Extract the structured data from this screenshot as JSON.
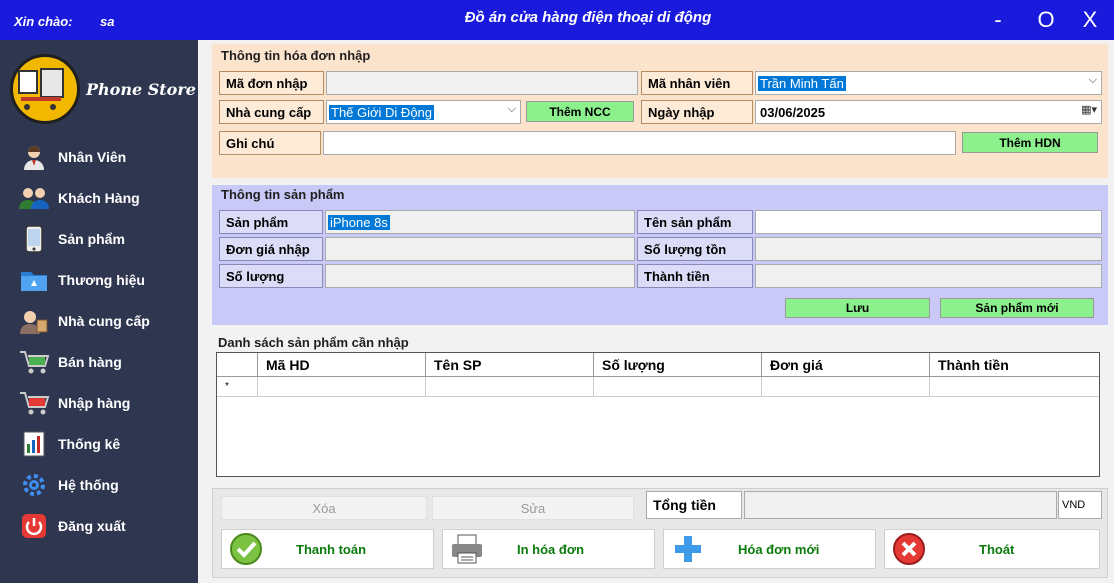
{
  "window": {
    "greeting": "Xin chào:",
    "user": "sa",
    "title": "Đồ án cửa hàng điện thoại di động",
    "min_glyph": "-",
    "max_glyph": "O",
    "close_glyph": "X"
  },
  "logo": {
    "text": "Phone Store"
  },
  "sidebar": {
    "items": [
      {
        "label": "Nhân Viên",
        "icon": "employee-icon"
      },
      {
        "label": "Khách Hàng",
        "icon": "customers-icon"
      },
      {
        "label": "Sản phẩm",
        "icon": "phone-icon"
      },
      {
        "label": "Thương hiệu",
        "icon": "folder-icon"
      },
      {
        "label": "Nhà cung cấp",
        "icon": "supplier-icon"
      },
      {
        "label": "Bán hàng",
        "icon": "cart-icon"
      },
      {
        "label": "Nhập hàng",
        "icon": "cart-icon"
      },
      {
        "label": "Thống kê",
        "icon": "report-icon"
      },
      {
        "label": "Hệ thống",
        "icon": "gear-icon"
      },
      {
        "label": "Đăng xuất",
        "icon": "power-icon"
      }
    ]
  },
  "invoice": {
    "section_title": "Thông tin hóa đơn nhập",
    "ma_don_label": "Mã đơn nhập",
    "ma_don_value": "",
    "ma_nv_label": "Mã nhân viên",
    "ma_nv_value": "Trần Minh Tấn",
    "ncc_label": "Nhà cung cấp",
    "ncc_value": "Thế Giới Di Động",
    "them_ncc": "Thêm NCC",
    "ngay_label": "Ngày nhập",
    "ngay_value": "03/06/2025",
    "ghichu_label": "Ghi chú",
    "ghichu_value": "",
    "them_hdn": "Thêm HDN"
  },
  "product": {
    "section_title": "Thông tin sản phẩm",
    "sp_label": "Sản phẩm",
    "sp_value": "iPhone 8s",
    "ten_label": "Tên sản phẩm",
    "dongia_label": "Đơn giá nhập",
    "soluongton_label": "Số lượng tồn",
    "soluong_label": "Số lượng",
    "thanhtien_label": "Thành tiền",
    "luu": "Lưu",
    "sp_moi": "Sản phẩm mới"
  },
  "grid": {
    "title": "Danh sách sản phẩm cần nhập",
    "columns": [
      "Mã HD",
      "Tên SP",
      "Số lượng",
      "Đơn giá",
      "Thành tiền"
    ],
    "new_row_marker": "*"
  },
  "bottom": {
    "xoa": "Xóa",
    "sua": "Sửa",
    "tong_tien_label": "Tổng tiền",
    "tong_tien_value": "",
    "currency": "VND",
    "actions": [
      {
        "label": "Thanh toán",
        "icon": "check-icon"
      },
      {
        "label": "In hóa đơn",
        "icon": "printer-icon"
      },
      {
        "label": "Hóa đơn mới",
        "icon": "plus-icon"
      },
      {
        "label": "Thoát",
        "icon": "exit-icon"
      }
    ]
  },
  "colors": {
    "titlebar": "#1a1adc",
    "sidebar": "#2e3650",
    "invoice_panel": "#fce4cc",
    "product_panel": "#c9c9f7",
    "green_button": "#8cf08c",
    "selection": "#0078d7"
  }
}
